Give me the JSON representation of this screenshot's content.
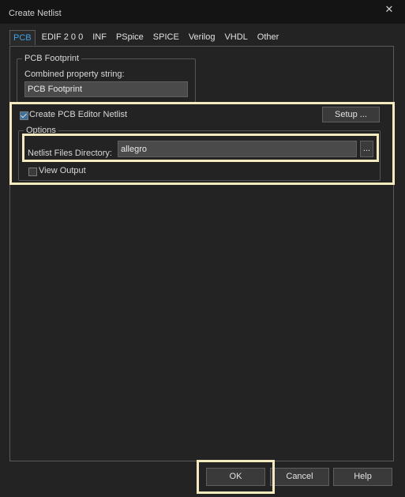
{
  "window": {
    "title": "Create Netlist",
    "close_glyph": "✕"
  },
  "tabs": [
    {
      "label": "PCB",
      "active": true
    },
    {
      "label": "EDIF 2 0 0",
      "active": false
    },
    {
      "label": "INF",
      "active": false
    },
    {
      "label": "PSpice",
      "active": false
    },
    {
      "label": "SPICE",
      "active": false
    },
    {
      "label": "Verilog",
      "active": false
    },
    {
      "label": "VHDL",
      "active": false
    },
    {
      "label": "Other",
      "active": false
    }
  ],
  "pcb_footprint": {
    "group_label": "PCB Footprint",
    "combined_label": "Combined property string:",
    "combined_value": "PCB Footprint"
  },
  "pcb_editor": {
    "create_label": "Create PCB Editor Netlist",
    "create_checked": true,
    "setup_label": "Setup ...",
    "options_label": "Options",
    "directory_label": "Netlist Files Directory:",
    "directory_value": "allegro",
    "browse_label": "...",
    "view_output_label": "View Output",
    "view_output_checked": false
  },
  "footer": {
    "ok_label": "OK",
    "cancel_label": "Cancel",
    "help_label": "Help"
  },
  "colors": {
    "accent_tab": "#3fa3e8",
    "highlight": "#f3eac0",
    "background": "#232323"
  }
}
